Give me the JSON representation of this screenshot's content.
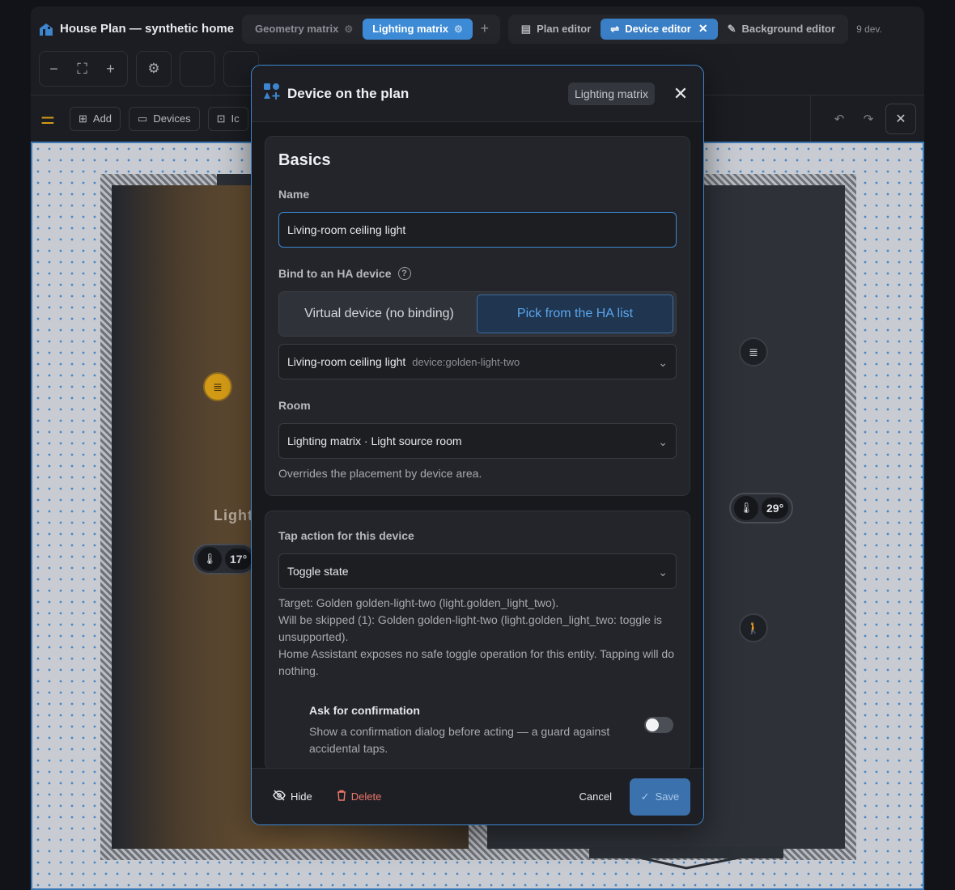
{
  "header": {
    "title": "House Plan — synthetic home",
    "plan_tabs": [
      {
        "label": "Geometry matrix",
        "active": false
      },
      {
        "label": "Lighting matrix",
        "active": true
      }
    ],
    "mode_tabs": [
      {
        "label": "Plan editor",
        "active": false
      },
      {
        "label": "Device editor",
        "active": true
      },
      {
        "label": "Background editor",
        "active": false
      }
    ],
    "device_count": "9 dev."
  },
  "toolbar": {
    "add": "Add",
    "devices": "Devices",
    "icons": "Ic"
  },
  "canvas": {
    "room_label": "Light",
    "temps": {
      "left": "17°",
      "right": "29°"
    }
  },
  "colors": {
    "accent": "#3d86cf",
    "danger": "#f0766a",
    "light_on": "#d39a16"
  },
  "modal": {
    "title": "Device on the plan",
    "badge": "Lighting matrix",
    "basics": {
      "heading": "Basics",
      "name_label": "Name",
      "name_value": "Living-room ceiling light",
      "bind_label": "Bind to an HA device",
      "bind_options": [
        "Virtual device (no binding)",
        "Pick from the HA list"
      ],
      "bind_selected": 1,
      "device_value": "Living-room ceiling light",
      "device_id": "device:golden-light-two",
      "room_label": "Room",
      "room_value": "Lighting matrix · Light source room",
      "room_help": "Overrides the placement by device area."
    },
    "tap": {
      "label": "Tap action for this device",
      "value": "Toggle state",
      "help_lines": [
        "Target: Golden golden-light-two (light.golden_light_two).",
        "Will be skipped (1): Golden golden-light-two (light.golden_light_two: toggle is unsupported).",
        "Home Assistant exposes no safe toggle operation for this entity. Tapping will do nothing."
      ],
      "confirm_title": "Ask for confirmation",
      "confirm_desc": "Show a confirmation dialog before acting — a guard against accidental taps.",
      "confirm_on": false
    },
    "footer": {
      "hide": "Hide",
      "delete": "Delete",
      "cancel": "Cancel",
      "save": "Save"
    }
  }
}
